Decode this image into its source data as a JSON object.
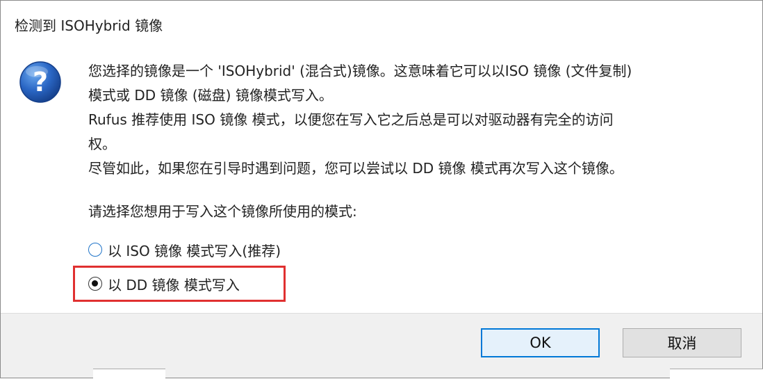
{
  "dialog": {
    "title": "检测到 ISOHybrid 镜像",
    "icon": "question-icon",
    "message_lines": [
      "您选择的镜像是一个 'ISOHybrid' (混合式)镜像。这意味着它可以以ISO 镜像 (文件复制)",
      "模式或 DD 镜像 (磁盘) 镜像模式写入。",
      "Rufus 推荐使用 ISO 镜像 模式，以便您在写入它之后总是可以对驱动器有完全的访问",
      "权。",
      "尽管如此，如果您在引导时遇到问题，您可以尝试以 DD 镜像 模式再次写入这个镜像。"
    ],
    "prompt": "请选择您想用于写入这个镜像所使用的模式:",
    "options": [
      {
        "label": "以 ISO 镜像 模式写入(推荐)",
        "selected": false
      },
      {
        "label": "以 DD 镜像 模式写入",
        "selected": true
      }
    ],
    "ok_label": "OK",
    "cancel_label": "取消",
    "colors": {
      "highlight": "#e03030",
      "accent": "#0078d7",
      "icon_blue": "#1f5fb4"
    }
  }
}
